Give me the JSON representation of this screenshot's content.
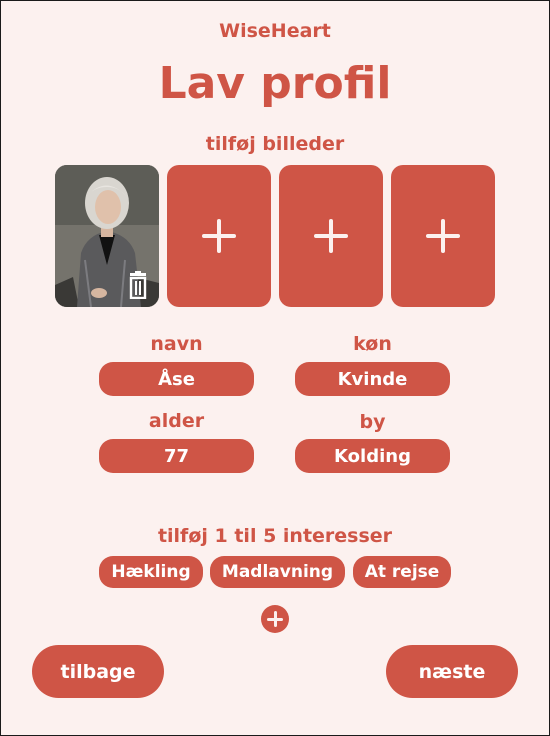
{
  "app": {
    "title": "WiseHeart"
  },
  "page": {
    "title": "Lav profil"
  },
  "photos": {
    "label": "tilføj billeder",
    "slots": [
      "photo",
      "add",
      "add",
      "add"
    ]
  },
  "profile": {
    "name_label": "navn",
    "name_value": "Åse",
    "gender_label": "køn",
    "gender_value": "Kvinde",
    "age_label": "alder",
    "age_value": "77",
    "city_label": "by",
    "city_value": "Kolding"
  },
  "interests": {
    "label": "tilføj 1 til 5 interesser",
    "items": [
      "Hækling",
      "Madlavning",
      "At rejse"
    ]
  },
  "nav": {
    "back_label": "tilbage",
    "next_label": "næste"
  },
  "colors": {
    "accent": "#cf5546",
    "background": "#fcf1ef"
  },
  "icons": {
    "add": "plus-icon",
    "delete": "trash-icon"
  }
}
